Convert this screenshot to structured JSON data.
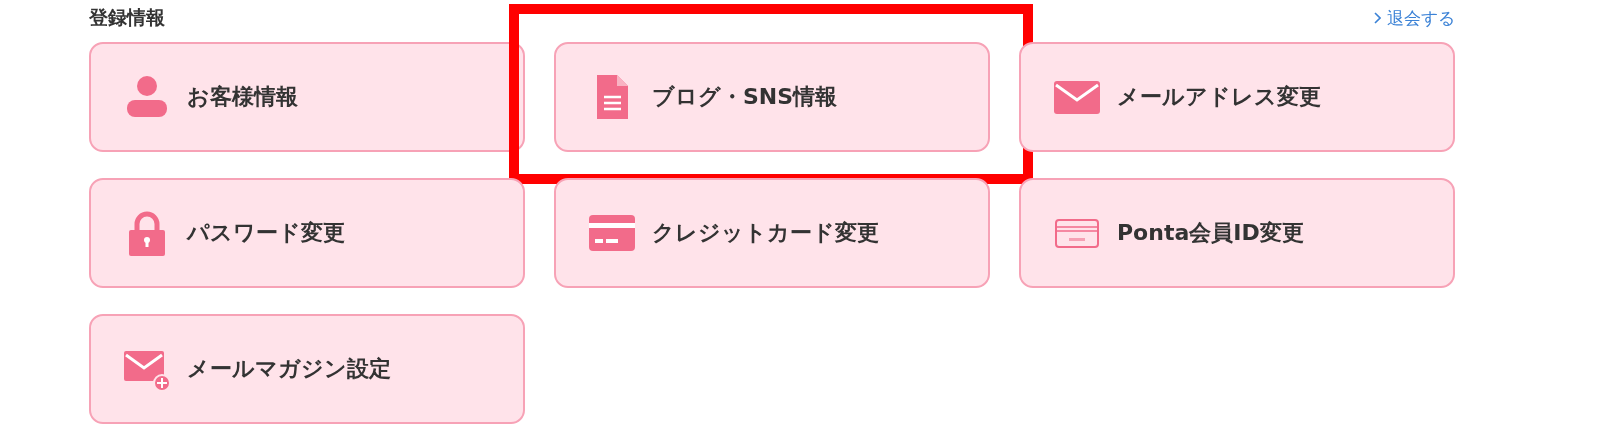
{
  "section": {
    "title": "登録情報",
    "link": "退会する"
  },
  "items": [
    {
      "label": "お客様情報",
      "kind": "person",
      "highlighted": false
    },
    {
      "label": "ブログ・SNS情報",
      "kind": "document",
      "highlighted": true
    },
    {
      "label": "メールアドレス変更",
      "kind": "mail",
      "highlighted": false
    },
    {
      "label": "パスワード変更",
      "kind": "lock",
      "highlighted": false
    },
    {
      "label": "クレジットカード変更",
      "kind": "card",
      "highlighted": false
    },
    {
      "label": "Ponta会員ID変更",
      "kind": "point",
      "highlighted": false
    },
    {
      "label": "メールマガジン設定",
      "kind": "mailplus",
      "highlighted": false
    }
  ]
}
